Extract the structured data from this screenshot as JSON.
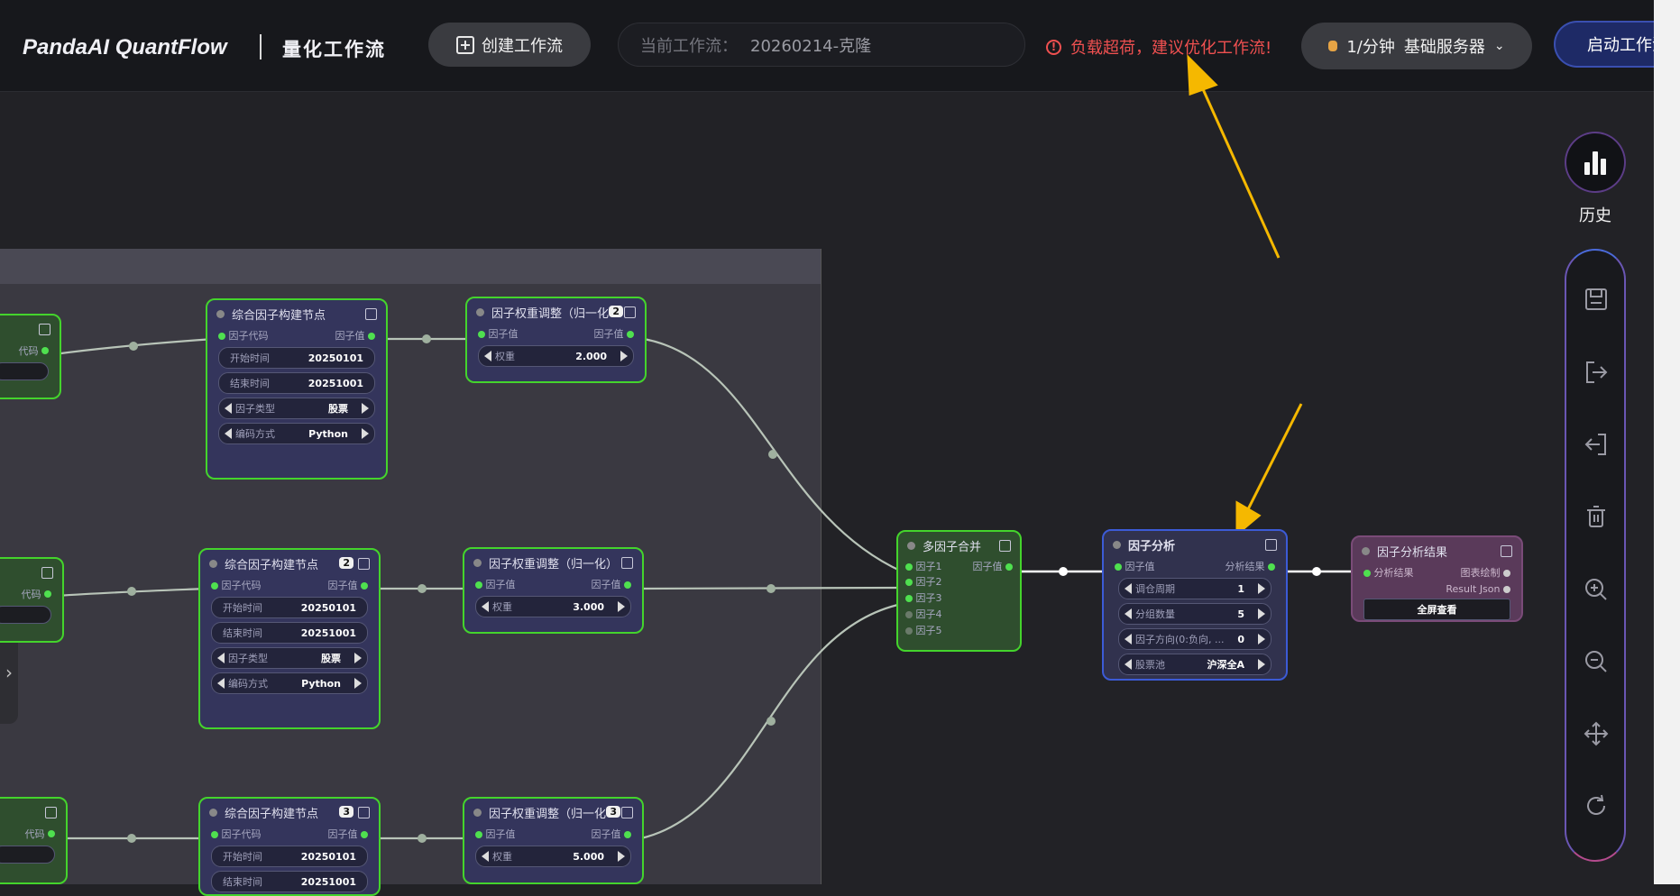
{
  "header": {
    "brand": "PandaAI QuantFlow",
    "brand_sub": "量化工作流",
    "create_label": "创建工作流",
    "current_wf_label": "当前工作流：",
    "current_wf_value": "20260214-克隆",
    "warning_text": "负载超荷，建议优化工作流!",
    "server_rate": "1/分钟",
    "server_name": "基础服务器",
    "start_label": "启动工作流"
  },
  "sidebar": {
    "history_label": "历史",
    "tools": [
      "save-icon",
      "export-icon",
      "import-icon",
      "trash-icon",
      "zoom-in-icon",
      "zoom-out-icon",
      "move-icon",
      "refresh-icon"
    ]
  },
  "nodes": {
    "left_partial": [
      {
        "output_label": "代码"
      },
      {
        "output_label": "代码"
      },
      {
        "output_label": "代码"
      }
    ],
    "build": [
      {
        "title": "综合因子构建节点",
        "badge": "",
        "in_label": "因子代码",
        "out_label": "因子值",
        "start_label": "开始时间",
        "start": "20250101",
        "end_label": "结束时间",
        "end": "20251001",
        "type_label": "因子类型",
        "type": "股票",
        "enc_label": "编码方式",
        "enc": "Python"
      },
      {
        "title": "综合因子构建节点",
        "badge": "2",
        "in_label": "因子代码",
        "out_label": "因子值",
        "start_label": "开始时间",
        "start": "20250101",
        "end_label": "结束时间",
        "end": "20251001",
        "type_label": "因子类型",
        "type": "股票",
        "enc_label": "编码方式",
        "enc": "Python"
      },
      {
        "title": "综合因子构建节点",
        "badge": "3",
        "in_label": "因子代码",
        "out_label": "因子值",
        "start_label": "开始时间",
        "start": "20250101",
        "end_label": "结束时间",
        "end": "20251001"
      }
    ],
    "weight": [
      {
        "title": "因子权重调整（归一化",
        "badge": "2",
        "in_label": "因子值",
        "out_label": "因子值",
        "w_label": "权重",
        "w": "2.000"
      },
      {
        "title": "因子权重调整（归一化）",
        "badge": "",
        "in_label": "因子值",
        "out_label": "因子值",
        "w_label": "权重",
        "w": "3.000"
      },
      {
        "title": "因子权重调整（归一化",
        "badge": "3",
        "in_label": "因子值",
        "out_label": "因子值",
        "w_label": "权重",
        "w": "5.000"
      }
    ],
    "merge": {
      "title": "多因子合并",
      "out_label": "因子值",
      "inputs": [
        "因子1",
        "因子2",
        "因子3",
        "因子4",
        "因子5"
      ]
    },
    "analysis": {
      "title": "因子分析",
      "in_label": "因子值",
      "out_label": "分析结果",
      "fields": [
        {
          "label": "调仓周期",
          "value": "1"
        },
        {
          "label": "分组数量",
          "value": "5"
        },
        {
          "label": "因子方向(0:负向, ...",
          "value": "0"
        },
        {
          "label": "股票池",
          "value": "沪深全A"
        }
      ]
    },
    "result": {
      "title": "因子分析结果",
      "in_label": "分析结果",
      "out1": "图表绘制",
      "out2": "Result Json",
      "btn": "全屏查看"
    }
  },
  "colors": {
    "accent_green": "#44d42c",
    "warning": "#ef5050",
    "annotation_arrow": "#f5b800"
  }
}
